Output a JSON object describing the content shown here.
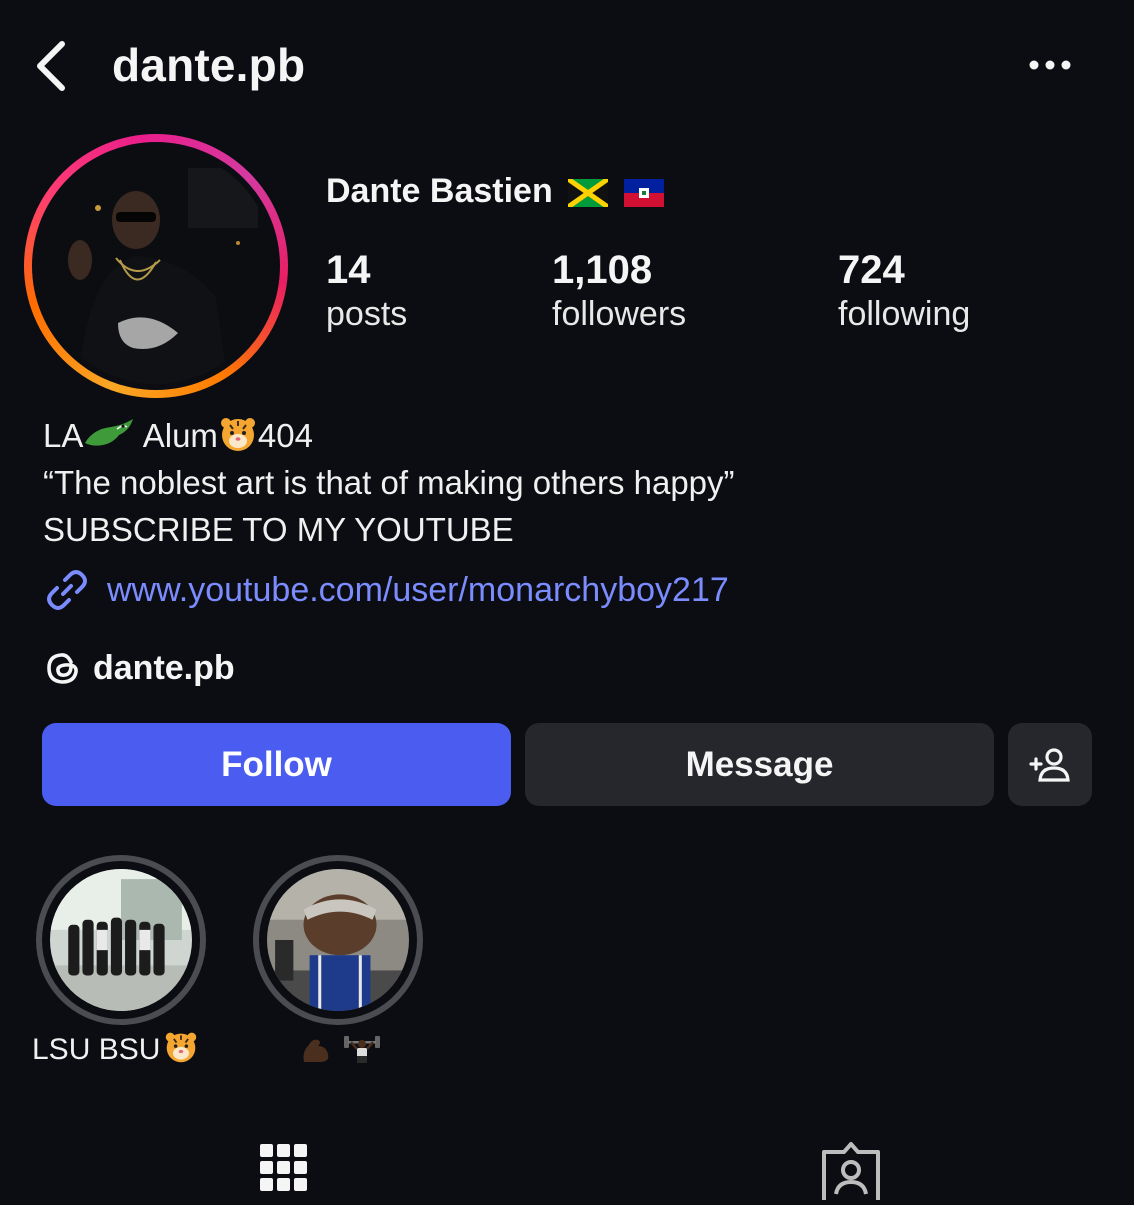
{
  "header": {
    "username": "dante.pb",
    "back_icon": "chevron-left-icon",
    "more_icon": "more-horizontal-icon"
  },
  "profile": {
    "display_name": "Dante Bastien",
    "flags": [
      "jamaica-flag",
      "haiti-flag"
    ],
    "stats": [
      {
        "value": "14",
        "label": "posts"
      },
      {
        "value": "1,108",
        "label": "followers"
      },
      {
        "value": "724",
        "label": "following"
      }
    ]
  },
  "bio": {
    "line1_part1": "LA",
    "line1_part2": " Alum",
    "line1_part3": "404",
    "line2": "“The noblest art is that of making others happy”",
    "line3": "SUBSCRIBE TO MY YOUTUBE"
  },
  "link": {
    "text": "www.youtube.com/user/monarchyboy217",
    "icon": "link-icon"
  },
  "threads": {
    "handle": "dante.pb",
    "icon": "threads-icon"
  },
  "actions": {
    "follow_label": "Follow",
    "message_label": "Message",
    "add_user_icon": "add-user-icon"
  },
  "highlights": [
    {
      "label": "LSU BSU",
      "emoji": "tiger-emoji"
    },
    {
      "label": "",
      "emoji": "flexed-biceps-and-weightlifter-emoji"
    }
  ],
  "tabs": [
    {
      "icon": "grid-icon"
    },
    {
      "icon": "tagged-person-icon"
    }
  ],
  "colors": {
    "background": "#0b0d12",
    "follow_button": "#4a5df0",
    "secondary_button": "#25272d",
    "link": "#7b8cff",
    "ring_start": "#f9a825",
    "ring_end": "#d43aa0"
  }
}
